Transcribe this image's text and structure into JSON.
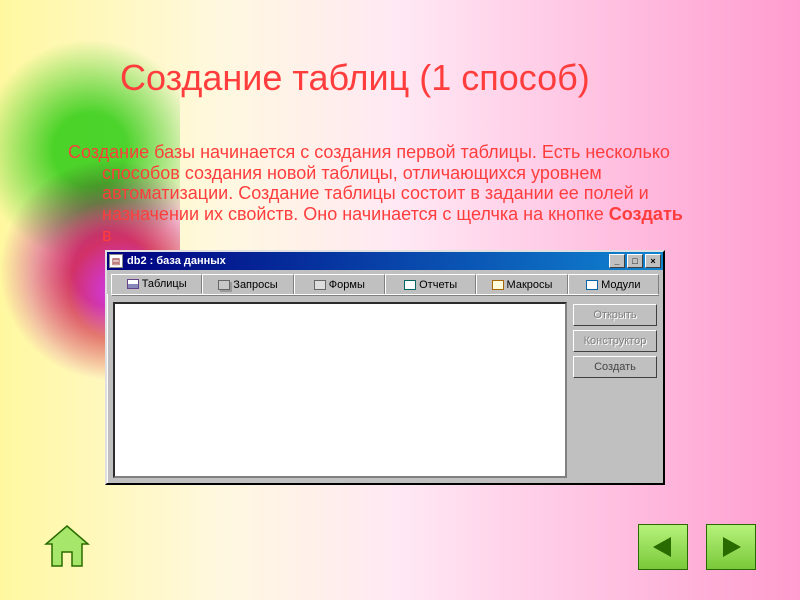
{
  "slide": {
    "title": "Создание таблиц (1 способ)",
    "body_pre": "Создание базы начинается с создания первой таблицы. Есть несколько способов создания новой таблицы, отличающихся уровнем автоматизации. Создание таблицы состоит в задании ее полей и назначении их свойств. Оно начинается с щелчка на кнопке ",
    "body_bold": "Создать",
    "body_post": " в"
  },
  "window": {
    "title": "db2 : база данных",
    "icon_label": "▤",
    "min": "_",
    "max": "□",
    "close": "×",
    "tabs": [
      {
        "label": "Таблицы",
        "icon": "tables",
        "active": true
      },
      {
        "label": "Запросы",
        "icon": "queries",
        "active": false
      },
      {
        "label": "Формы",
        "icon": "forms",
        "active": false
      },
      {
        "label": "Отчеты",
        "icon": "reports",
        "active": false
      },
      {
        "label": "Макросы",
        "icon": "macros",
        "active": false
      },
      {
        "label": "Модули",
        "icon": "modules",
        "active": false
      }
    ],
    "right_buttons": [
      {
        "label": "Открыть",
        "enabled": false
      },
      {
        "label": "Конструктор",
        "enabled": false
      },
      {
        "label": "Создать",
        "enabled": true
      }
    ]
  },
  "nav": {
    "home": "home-icon",
    "prev": "prev-icon",
    "next": "next-icon"
  }
}
